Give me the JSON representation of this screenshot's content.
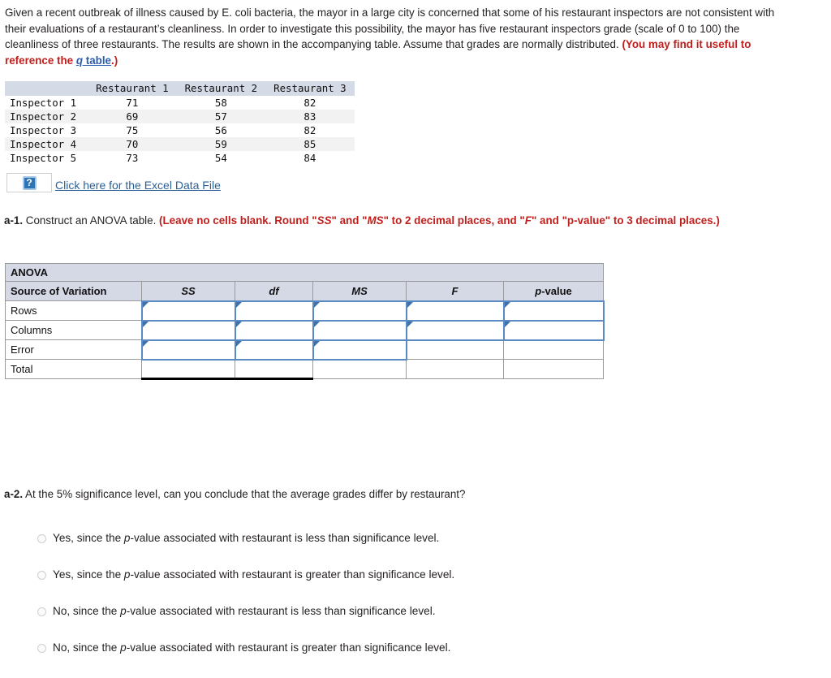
{
  "intro": {
    "text_part1": "Given a recent outbreak of illness caused by E. coli bacteria, the mayor in a large city is concerned that some of his restaurant inspectors are not consistent with their evaluations of a restaurant’s cleanliness. In order to investigate this possibility, the mayor has five restaurant inspectors grade (scale of 0 to 100) the cleanliness of three restaurants. The results are shown in the accompanying table. Assume that grades are normally distributed. ",
    "red_open": "(You may find it useful to reference the ",
    "link_italic": "q",
    "link_rest": " table",
    "red_close": ".)"
  },
  "data_table": {
    "corner": "",
    "columns": [
      "Restaurant 1",
      "Restaurant 2",
      "Restaurant 3"
    ],
    "rows": [
      {
        "label": "Inspector 1",
        "values": [
          "71",
          "58",
          "82"
        ]
      },
      {
        "label": "Inspector 2",
        "values": [
          "69",
          "57",
          "83"
        ]
      },
      {
        "label": "Inspector 3",
        "values": [
          "75",
          "56",
          "82"
        ]
      },
      {
        "label": "Inspector 4",
        "values": [
          "70",
          "59",
          "85"
        ]
      },
      {
        "label": "Inspector 5",
        "values": [
          "73",
          "54",
          "84"
        ]
      }
    ]
  },
  "excel": {
    "icon_glyph": "?",
    "icon_name": "broken-image-placeholder-icon",
    "link_label": "Click here for the Excel Data File"
  },
  "a1": {
    "lead": "a-1.",
    "body": " Construct an ANOVA table. ",
    "red_1": "(Leave no cells blank. Round \"",
    "red_ss": "SS",
    "red_2": "\" and \"",
    "red_ms": "MS",
    "red_3": "\" to 2 decimal places, and \"",
    "red_f": "F",
    "red_4": "\" and \"p-value\" to 3 decimal places.)"
  },
  "anova": {
    "title": "ANOVA",
    "headers": {
      "source": "Source of Variation",
      "ss": "SS",
      "df": "df",
      "ms": "MS",
      "f": "F",
      "p_italic": "p",
      "p_rest": "-value"
    },
    "rows": [
      {
        "label": "Rows",
        "cells": [
          "",
          "",
          "",
          "",
          ""
        ]
      },
      {
        "label": "Columns",
        "cells": [
          "",
          "",
          "",
          "",
          ""
        ]
      },
      {
        "label": "Error",
        "cells": [
          "",
          "",
          "",
          "",
          ""
        ]
      },
      {
        "label": "Total",
        "cells": [
          "",
          "",
          "",
          "",
          ""
        ]
      }
    ]
  },
  "a2": {
    "lead": "a-2.",
    "body": " At the 5% significance level, can you conclude that the average grades differ by restaurant?"
  },
  "options": [
    {
      "prefix": "Yes, since the ",
      "italic": "p",
      "suffix": "-value associated with restaurant is less than significance level."
    },
    {
      "prefix": "Yes, since the ",
      "italic": "p",
      "suffix": "-value associated with restaurant is greater than significance level."
    },
    {
      "prefix": "No, since the ",
      "italic": "p",
      "suffix": "-value associated with restaurant is less than significance level."
    },
    {
      "prefix": "No, since the ",
      "italic": "p",
      "suffix": "-value associated with restaurant is greater than significance level."
    }
  ],
  "colors": {
    "red_emphasis": "#c0201d",
    "link_blue": "#2a5db0",
    "header_fill": "#d5d9e6",
    "input_border": "#5b8ac2"
  }
}
